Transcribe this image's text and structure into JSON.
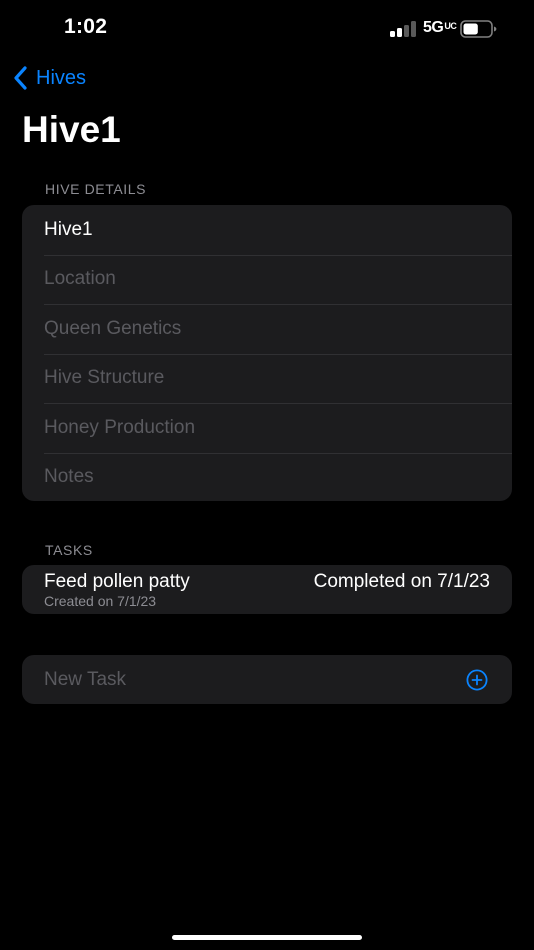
{
  "status_bar": {
    "time": "1:02",
    "network": "5GUC",
    "signal_bars_active": 2,
    "battery_level_fraction": 0.55
  },
  "colors": {
    "accent": "#0a84ff",
    "background": "#000000",
    "card": "#1c1c1e",
    "secondary_text": "#8d8d93",
    "placeholder_text": "#5a5a5f"
  },
  "nav": {
    "back_label": "Hives",
    "back_icon": "chevron-left-icon"
  },
  "page": {
    "title": "Hive1"
  },
  "hive_details": {
    "header": "HIVE DETAILS",
    "name_value": "Hive1",
    "location_placeholder": "Location",
    "queen_genetics_placeholder": "Queen Genetics",
    "hive_structure_placeholder": "Hive Structure",
    "honey_production_placeholder": "Honey Production",
    "notes_placeholder": "Notes"
  },
  "tasks": {
    "header": "TASKS",
    "items": [
      {
        "title": "Feed pollen patty",
        "created": "Created on 7/1/23",
        "status": "Completed on 7/1/23"
      }
    ],
    "new_task_placeholder": "New Task",
    "add_icon": "plus-circle-icon"
  }
}
